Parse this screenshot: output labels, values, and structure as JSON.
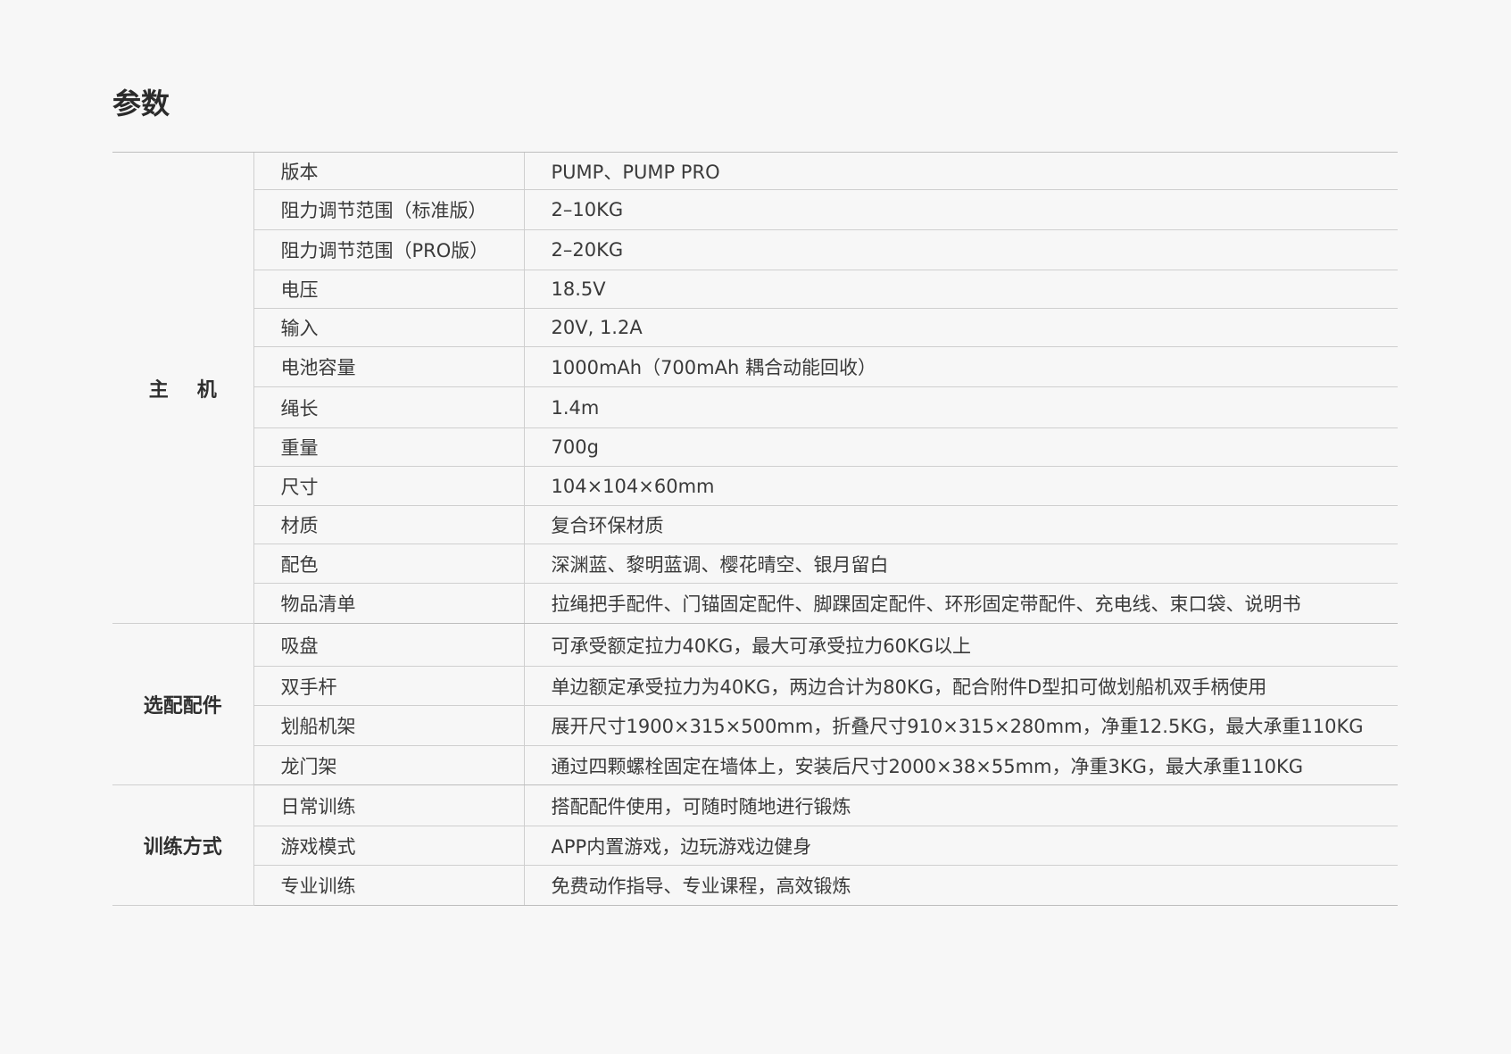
{
  "page": {
    "title": "参数"
  },
  "colors": {
    "background": "#f7f7f7",
    "text": "#3a3a3a",
    "border": "#cfcfcf"
  },
  "groups": [
    {
      "name": "主机",
      "rows": [
        {
          "label": "版本",
          "value": "PUMP、PUMP PRO"
        },
        {
          "label": "阻力调节范围（标准版）",
          "value": "2–10KG"
        },
        {
          "label": "阻力调节范围（PRO版）",
          "value": "2–20KG"
        },
        {
          "label": "电压",
          "value": "18.5V"
        },
        {
          "label": "输入",
          "value": "20V, 1.2A"
        },
        {
          "label": "电池容量",
          "value": "1000mAh（700mAh 耦合动能回收）"
        },
        {
          "label": "绳长",
          "value": "1.4m"
        },
        {
          "label": "重量",
          "value": "700g"
        },
        {
          "label": "尺寸",
          "value": "104×104×60mm"
        },
        {
          "label": "材质",
          "value": "复合环保材质"
        },
        {
          "label": "配色",
          "value": "深渊蓝、黎明蓝调、樱花晴空、银月留白"
        },
        {
          "label": "物品清单",
          "value": "拉绳把手配件、门锚固定配件、脚踝固定配件、环形固定带配件、充电线、束口袋、说明书"
        }
      ]
    },
    {
      "name": "选配配件",
      "rows": [
        {
          "label": "吸盘",
          "value": "可承受额定拉力40KG，最大可承受拉力60KG以上"
        },
        {
          "label": "双手杆",
          "value": "单边额定承受拉力为40KG，两边合计为80KG，配合附件D型扣可做划船机双手柄使用"
        },
        {
          "label": "划船机架",
          "value": "展开尺寸1900×315×500mm，折叠尺寸910×315×280mm，净重12.5KG，最大承重110KG"
        },
        {
          "label": "龙门架",
          "value": "通过四颗螺栓固定在墙体上，安装后尺寸2000×38×55mm，净重3KG，最大承重110KG"
        }
      ]
    },
    {
      "name": "训练方式",
      "rows": [
        {
          "label": "日常训练",
          "value": "搭配配件使用，可随时随地进行锻炼"
        },
        {
          "label": "游戏模式",
          "value": "APP内置游戏，边玩游戏边健身"
        },
        {
          "label": "专业训练",
          "value": "免费动作指导、专业课程，高效锻炼"
        }
      ]
    }
  ]
}
